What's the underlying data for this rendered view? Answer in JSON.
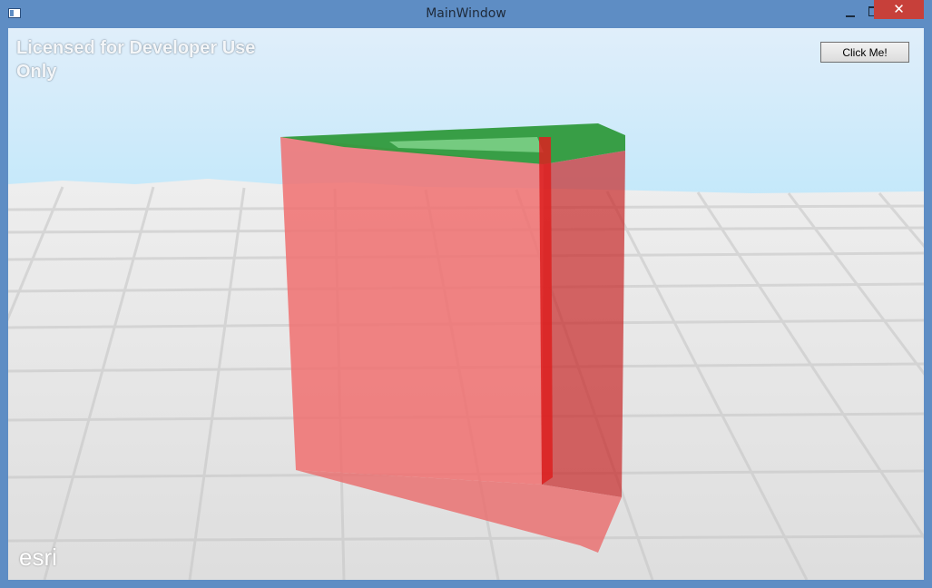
{
  "window": {
    "title": "MainWindow",
    "close_glyph": "✕"
  },
  "icons": {
    "app": "window-icon",
    "minimize": "minimize-icon",
    "maximize": "maximize-icon",
    "close": "close-icon"
  },
  "scene": {
    "license_text": "Licensed for Developer Use Only",
    "button_label": "Click Me!",
    "attribution": "esri",
    "colors": {
      "sky_top": "#ddeefa",
      "sky_bottom": "#c4e9fb",
      "ground": "#e3e3e3",
      "box_front": "#f07070",
      "box_side": "#c82828",
      "box_top": "#2f9a3c"
    }
  }
}
